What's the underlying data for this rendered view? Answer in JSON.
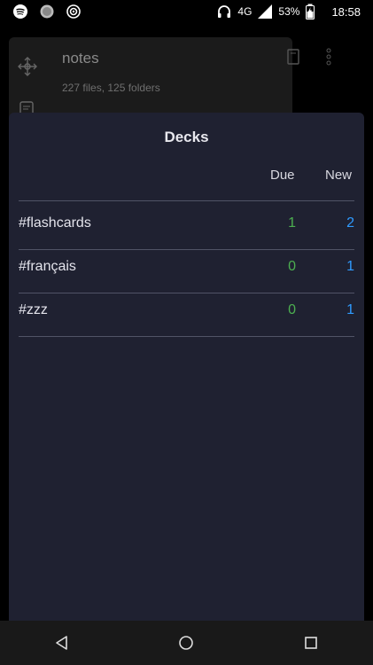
{
  "status_bar": {
    "network": "4G",
    "battery": "53%",
    "time": "18:58"
  },
  "background_app": {
    "title": "notes",
    "subtitle": "227 files, 125 folders"
  },
  "modal": {
    "title": "Decks",
    "columns": {
      "due": "Due",
      "new": "New"
    },
    "decks": [
      {
        "name": "#flashcards",
        "due": "1",
        "new": "2"
      },
      {
        "name": "#français",
        "due": "0",
        "new": "1"
      },
      {
        "name": "#zzz",
        "due": "0",
        "new": "1"
      }
    ]
  },
  "colors": {
    "modal_bg": "#1f2131",
    "due": "#4caf50",
    "new": "#2f9bff"
  }
}
